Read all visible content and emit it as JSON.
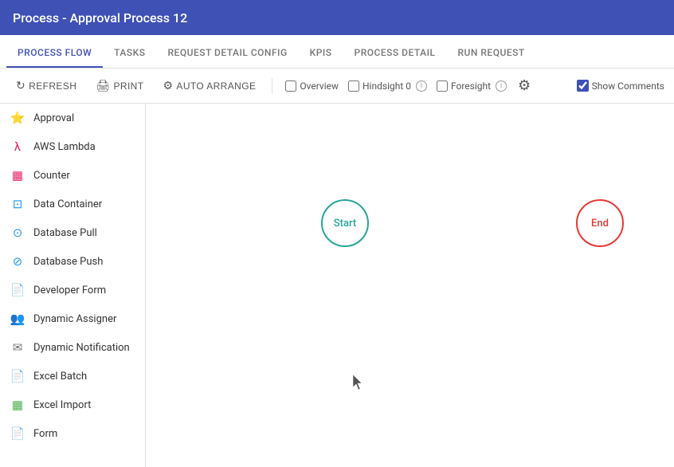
{
  "titleBar": {
    "title": "Process - Approval Process 12"
  },
  "tabs": [
    {
      "id": "process-flow",
      "label": "PROCESS FLOW",
      "active": true
    },
    {
      "id": "tasks",
      "label": "TASKS",
      "active": false
    },
    {
      "id": "request-detail-config",
      "label": "REQUEST DETAIL CONFIG",
      "active": false
    },
    {
      "id": "kpis",
      "label": "KPIS",
      "active": false
    },
    {
      "id": "process-detail",
      "label": "PROCESS DETAIL",
      "active": false
    },
    {
      "id": "run-request",
      "label": "RUN REQUEST",
      "active": false
    }
  ],
  "toolbar": {
    "refresh_label": "REFRESH",
    "print_label": "PRINT",
    "auto_arrange_label": "AUTO ARRANGE",
    "overview_label": "Overview",
    "hindsight_label": "Hindsight",
    "hindsight_count": "0",
    "foresight_label": "Foresight",
    "show_comments_label": "Show Comments",
    "show_comments_checked": true,
    "overview_checked": false,
    "hindsight_checked": false,
    "foresight_checked": false
  },
  "sidebar": {
    "items": [
      {
        "id": "approval",
        "label": "Approval",
        "icon": "⭐",
        "color": "#f59e0b"
      },
      {
        "id": "aws-lambda",
        "label": "AWS Lambda",
        "icon": "λ",
        "color": "#e91e63"
      },
      {
        "id": "counter",
        "label": "Counter",
        "icon": "▦",
        "color": "#e91e63"
      },
      {
        "id": "data-container",
        "label": "Data Container",
        "icon": "⊡",
        "color": "#2196f3"
      },
      {
        "id": "database-pull",
        "label": "Database Pull",
        "icon": "⊙",
        "color": "#2196f3"
      },
      {
        "id": "database-push",
        "label": "Database Push",
        "icon": "⊘",
        "color": "#2196f3"
      },
      {
        "id": "developer-form",
        "label": "Developer Form",
        "icon": "📄",
        "color": "#e53935"
      },
      {
        "id": "dynamic-assigner",
        "label": "Dynamic Assigner",
        "icon": "👥",
        "color": "#757575"
      },
      {
        "id": "dynamic-notification",
        "label": "Dynamic Notification",
        "icon": "✉",
        "color": "#757575"
      },
      {
        "id": "excel-batch",
        "label": "Excel Batch",
        "icon": "📄",
        "color": "#e53935"
      },
      {
        "id": "excel-import",
        "label": "Excel Import",
        "icon": "▦",
        "color": "#4caf50"
      },
      {
        "id": "form",
        "label": "Form",
        "icon": "📄",
        "color": "#e53935"
      }
    ]
  },
  "canvas": {
    "nodes": [
      {
        "id": "start",
        "label": "Start",
        "type": "start"
      },
      {
        "id": "end",
        "label": "End",
        "type": "end"
      }
    ]
  },
  "colors": {
    "accent": "#3f51b5",
    "start_node": "#26a69a",
    "end_node": "#e53935"
  }
}
